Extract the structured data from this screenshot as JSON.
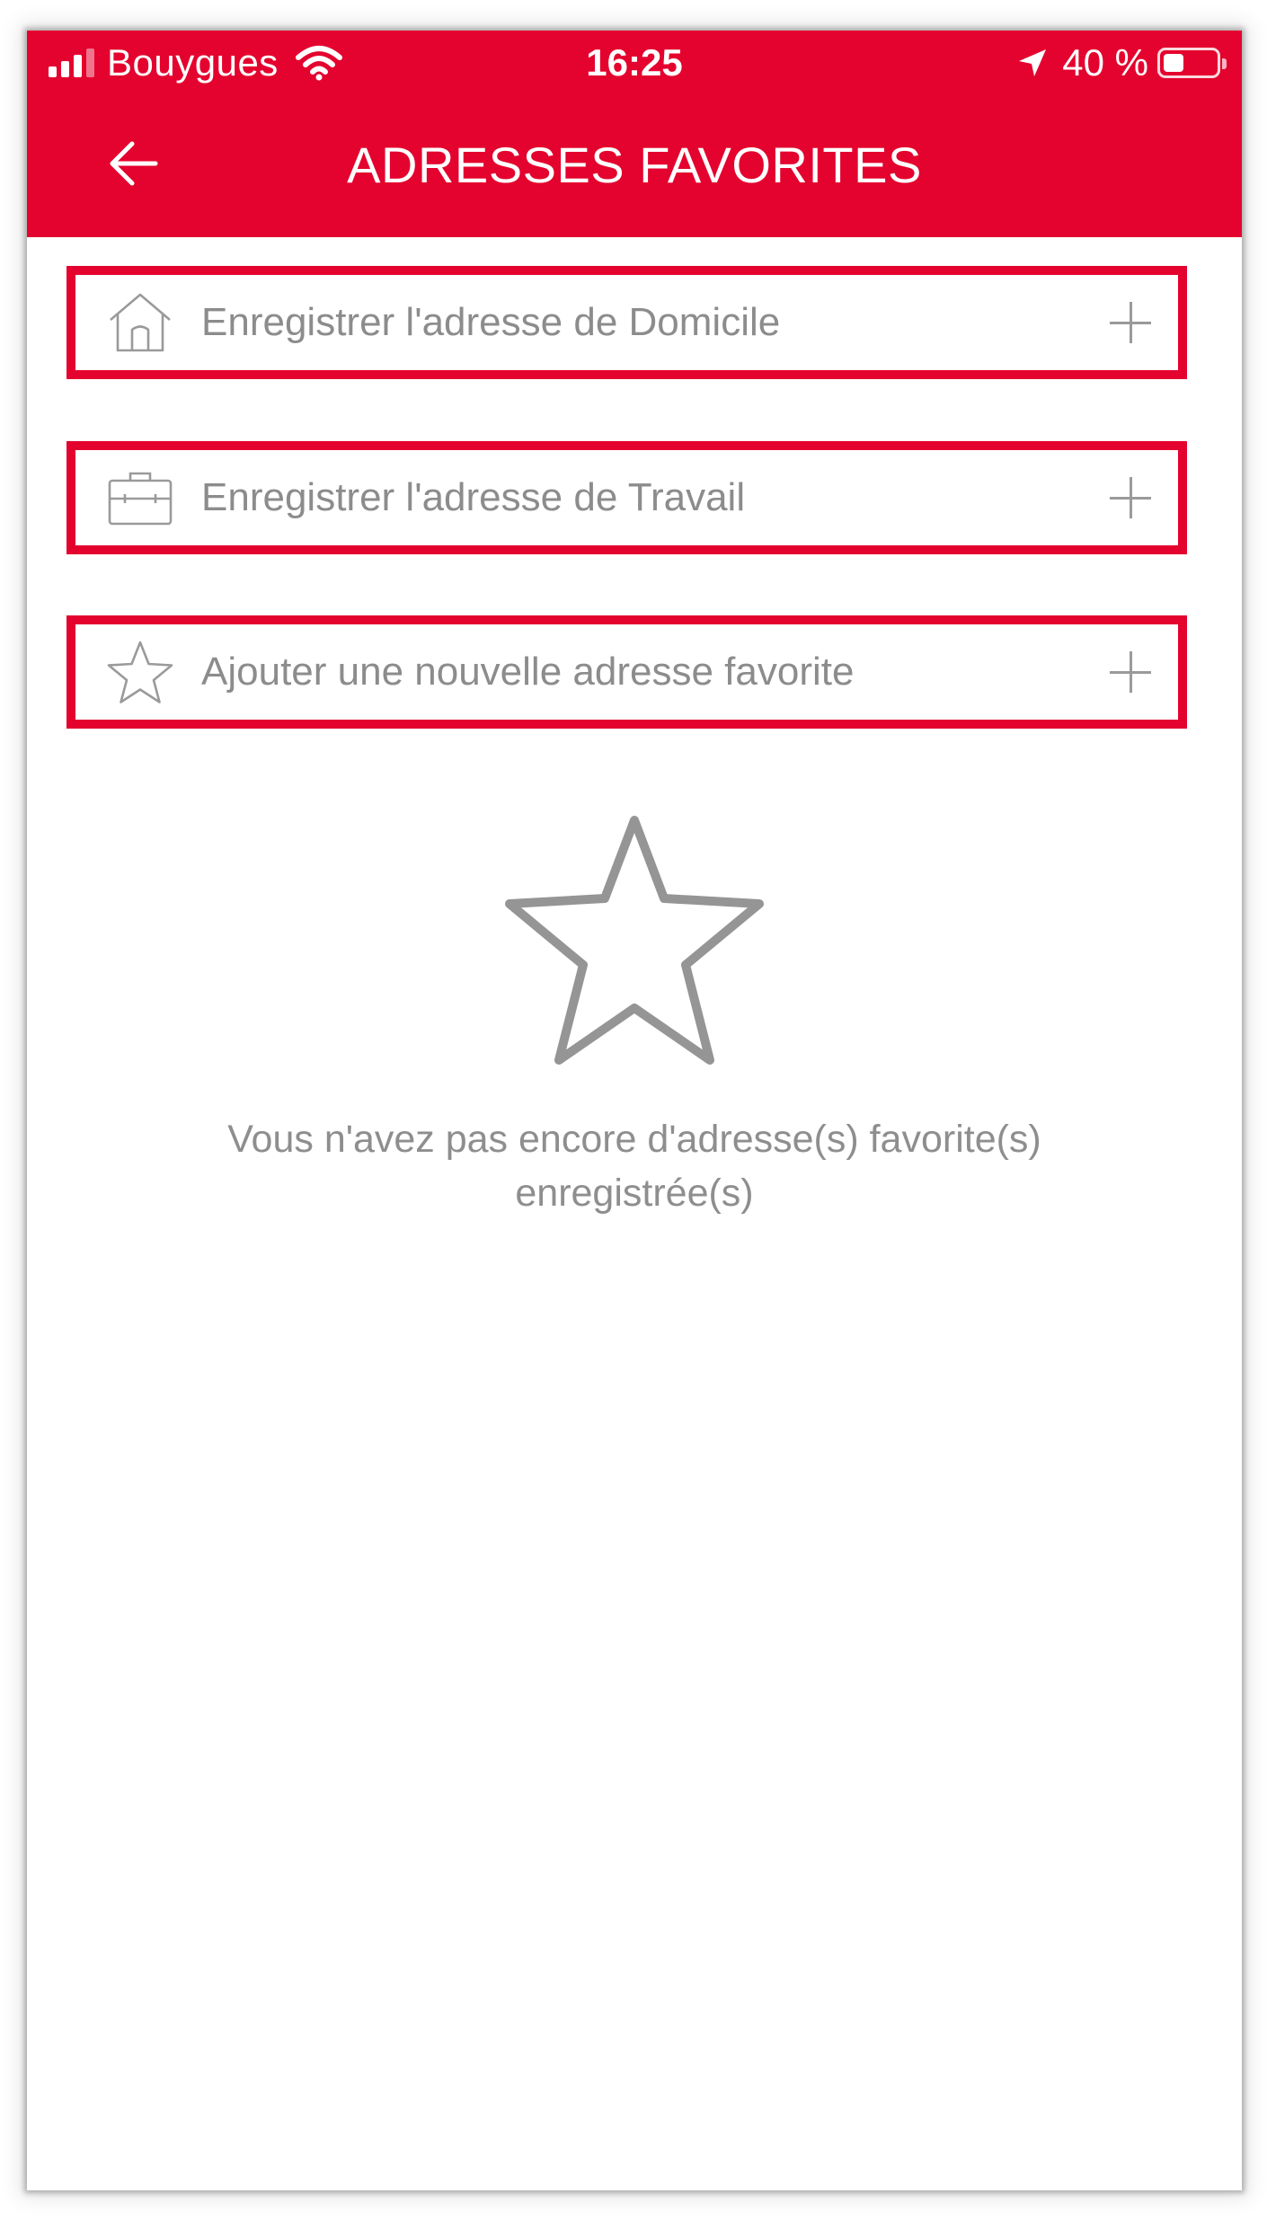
{
  "status_bar": {
    "carrier": "Bouygues",
    "time": "16:25",
    "battery_percent": "40 %",
    "battery_level": 0.4
  },
  "header": {
    "title": "ADRESSES FAVORITES",
    "background_color": "#e4032e"
  },
  "rows": [
    {
      "icon": "home-icon",
      "label": "Enregistrer l'adresse de Domicile"
    },
    {
      "icon": "briefcase-icon",
      "label": "Enregistrer l'adresse de Travail"
    },
    {
      "icon": "star-icon",
      "label": "Ajouter une nouvelle adresse favorite"
    }
  ],
  "empty_state": {
    "icon": "star-outline-icon",
    "line1": "Vous n'avez pas encore d'adresse(s) favorite(s)",
    "line2": "enregistrée(s)"
  },
  "colors": {
    "accent": "#e4032e",
    "muted_text": "#8c8c8c"
  }
}
